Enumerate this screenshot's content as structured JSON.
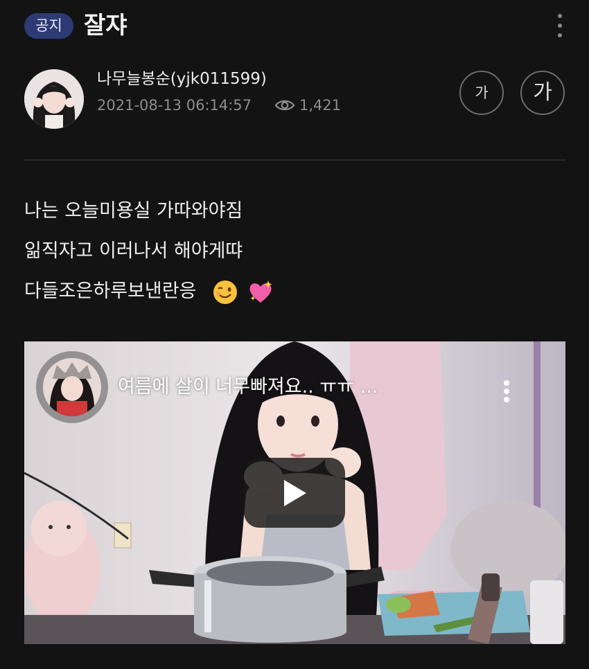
{
  "header": {
    "badge": "공지",
    "title": "잘쟈"
  },
  "post": {
    "author": "나무늘봉순(yjk011599)",
    "datetime": "2021-08-13 06:14:57",
    "views": "1,421",
    "font_small_label": "가",
    "font_large_label": "가"
  },
  "content": {
    "lines": [
      "나는 오늘미용실 가따와야짐",
      "읾직자고 이러나서 해야게땨",
      "다들조은하루보낸란응"
    ],
    "emojis": [
      "winking-face",
      "sparkling-heart"
    ]
  },
  "video": {
    "title": "여름에 살이 너무빠져요.. ㅠㅠ ..."
  },
  "colors": {
    "background": "#131313",
    "badge": "#2e3a73",
    "muted_text": "#8d8d8d"
  }
}
